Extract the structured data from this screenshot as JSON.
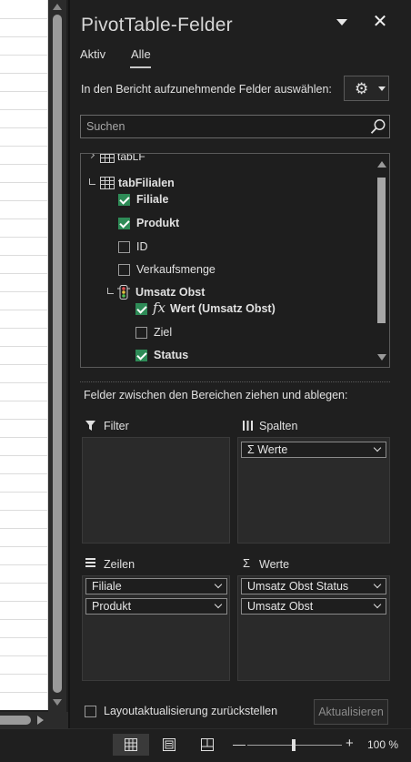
{
  "panel": {
    "title": "PivotTable-Felder",
    "close_glyph": "✕",
    "tabs": [
      "Aktiv",
      "Alle"
    ],
    "active_tab": "Alle",
    "choose_label": "In den Bericht aufzunehmende Felder auswählen:",
    "gear_icon": "gear-icon",
    "search_placeholder": "Suchen"
  },
  "field_list": {
    "rows": [
      {
        "kind": "table",
        "label": "tabLF",
        "partial": true
      },
      {
        "kind": "table",
        "label": "tabFilialen"
      },
      {
        "kind": "field",
        "label": "Filiale",
        "checked": true
      },
      {
        "kind": "field",
        "label": "Produkt",
        "checked": true
      },
      {
        "kind": "field",
        "label": "ID",
        "checked": false
      },
      {
        "kind": "field",
        "label": "Verkaufsmenge",
        "checked": false
      },
      {
        "kind": "kpi",
        "label": "Umsatz Obst"
      },
      {
        "kind": "kpi-field",
        "label": "Wert (Umsatz Obst)",
        "checked": true,
        "fx": "fx"
      },
      {
        "kind": "kpi-field",
        "label": "Ziel",
        "checked": false
      },
      {
        "kind": "kpi-field",
        "label": "Status",
        "checked": true
      }
    ]
  },
  "areas": {
    "drag_label": "Felder zwischen den Bereichen ziehen und ablegen:",
    "filter": {
      "label": "Filter",
      "items": []
    },
    "columns": {
      "label": "Spalten",
      "items": [
        "Σ Werte"
      ]
    },
    "rows": {
      "label": "Zeilen",
      "items": [
        "Filiale",
        "Produkt"
      ]
    },
    "values": {
      "label": "Werte",
      "items": [
        "Umsatz Obst Status",
        "Umsatz Obst"
      ]
    }
  },
  "footer": {
    "defer_label": "Layoutaktualisierung zurückstellen",
    "defer_checked": false,
    "update_label": "Aktualisieren"
  },
  "statusbar": {
    "zoom_minus": "—",
    "zoom_plus": "+",
    "zoom_value": "100 %"
  },
  "colors": {
    "checkbox_checked": "#2e8b57",
    "panel_bg": "#1f1f1f"
  }
}
